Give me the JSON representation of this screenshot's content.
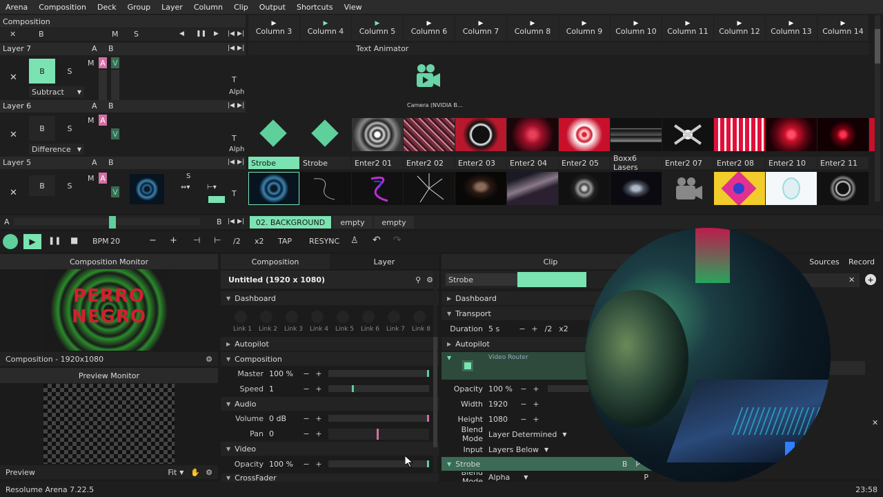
{
  "menu": [
    "Arena",
    "Composition",
    "Deck",
    "Group",
    "Layer",
    "Column",
    "Clip",
    "Output",
    "Shortcuts",
    "View"
  ],
  "comp_header": {
    "title": "Composition",
    "b": "B",
    "m": "M",
    "s": "S"
  },
  "columns": [
    "Column 3",
    "Column 4",
    "Column 5",
    "Column 6",
    "Column 7",
    "Column 8",
    "Column 9",
    "Column 10",
    "Column 11",
    "Column 12",
    "Column 13",
    "Column 14"
  ],
  "layers": [
    {
      "name": "Layer 7",
      "a": "A",
      "b": "B",
      "blend": "Subtract",
      "m": "M",
      "av": "A",
      "v": "V",
      "t": "T",
      "alph": "Alph"
    },
    {
      "name": "Layer 6",
      "a": "A",
      "b": "B",
      "blend": "Difference",
      "m": "M",
      "av": "A",
      "v": "V",
      "t": "T",
      "alph": "Alph"
    },
    {
      "name": "Layer 5",
      "a": "A",
      "b": "B",
      "m": "M",
      "av": "A",
      "v": "V",
      "t": "T",
      "s": "S"
    }
  ],
  "layer7_clips": {
    "text_animator": "Text Animator",
    "camera": "Camera (NVIDIA B..."
  },
  "layer6_clips": [
    "Strobe",
    "Strobe",
    "Enter2 01",
    "Enter2 02",
    "Enter2 03",
    "Enter2 04",
    "Enter2 05",
    "Boxx6 Lasers",
    "Enter2 07",
    "Enter2 08",
    "Enter2 10",
    "Enter2 11"
  ],
  "decks": {
    "a": "A",
    "b": "B",
    "active": "02. BACKGROUND",
    "tabs": [
      "empty",
      "empty"
    ]
  },
  "transport": {
    "bpm_label": "BPM",
    "bpm": "20",
    "half": "/2",
    "double": "x2",
    "tap": "TAP",
    "resync": "RESYNC"
  },
  "comp_monitor": {
    "title": "Composition Monitor",
    "art_line1": "PERRO",
    "art_line2": "NEGRO",
    "footer": "Composition - 1920x1080"
  },
  "preview_monitor": {
    "title": "Preview Monitor",
    "footer": "Preview",
    "fit": "Fit"
  },
  "composition_panel": {
    "tab": "Composition",
    "tab2": "Layer",
    "title": "Untitled (1920 x 1080)",
    "sections": {
      "dashboard": "Dashboard",
      "autopilot": "Autopilot",
      "composition": "Composition",
      "audio": "Audio",
      "video": "Video",
      "crossfader": "CrossFader"
    },
    "links": [
      "Link 1",
      "Link 2",
      "Link 3",
      "Link 4",
      "Link 5",
      "Link 6",
      "Link 7",
      "Link 8"
    ],
    "params": [
      {
        "label": "Master",
        "value": "100 %",
        "fill": 1.0
      },
      {
        "label": "Speed",
        "value": "1",
        "fill": 0.25
      },
      {
        "label": "Volume",
        "value": "0 dB",
        "fill": 1.0
      },
      {
        "label": "Pan",
        "value": "0",
        "fill": 0.5
      },
      {
        "label": "Opacity",
        "value": "100 %",
        "fill": 1.0
      }
    ]
  },
  "clip_panel": {
    "tab": "Clip",
    "name": "Strobe",
    "sections": {
      "dashboard": "Dashboard",
      "transport": "Transport",
      "autopilot": "Autopilot",
      "strobe": "Strobe"
    },
    "duration": {
      "label": "Duration",
      "value": "5 s",
      "half": "/2",
      "double": "x2"
    },
    "video_router": "Video Router",
    "params": [
      {
        "label": "Opacity",
        "value": "100 %"
      },
      {
        "label": "Width",
        "value": "1920"
      },
      {
        "label": "Height",
        "value": "1080"
      }
    ],
    "blend_mode": {
      "label": "Blend Mode",
      "value": "Layer Determined"
    },
    "input": {
      "label": "Input",
      "value": "Layers Below"
    },
    "blend_mode2": {
      "label": "Blend Mode",
      "value": "Alpha"
    },
    "b": "B",
    "p": "P"
  },
  "right_tabs": [
    "Sources",
    "Record"
  ],
  "status": {
    "app": "Resolume Arena 7.22.5",
    "time": "23:58"
  },
  "colors": {
    "accent": "#7be3b2",
    "bg": "#1b1b1b",
    "panel": "#262626",
    "pink": "#d46fa4"
  }
}
